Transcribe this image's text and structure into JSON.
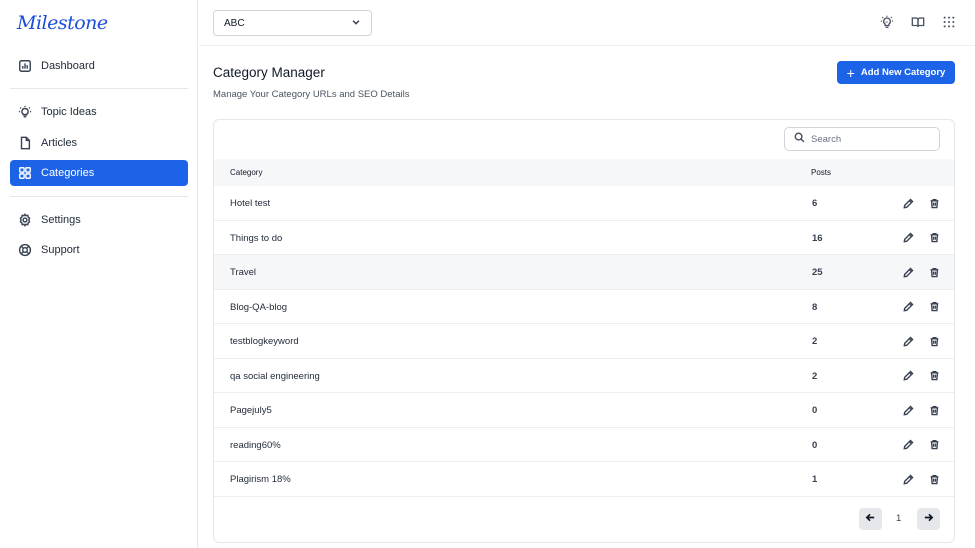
{
  "app": {
    "logo": "Milestone"
  },
  "sidebar": {
    "items": [
      {
        "label": "Dashboard",
        "icon": "chart-bar-icon"
      },
      {
        "label": "Topic Ideas",
        "icon": "lightbulb-icon"
      },
      {
        "label": "Articles",
        "icon": "document-icon"
      },
      {
        "label": "Categories",
        "icon": "grid-icon",
        "active": true
      },
      {
        "label": "Settings",
        "icon": "gear-icon"
      },
      {
        "label": "Support",
        "icon": "lifebuoy-icon"
      }
    ]
  },
  "topbar": {
    "site_selected": "ABC",
    "icons": [
      "ai-bulb-icon",
      "book-icon",
      "apps-grid-icon"
    ]
  },
  "main": {
    "title": "Category Manager",
    "subtitle": "Manage Your Category URLs and SEO Details",
    "add_button_label": "Add New Category",
    "search_placeholder": "Search",
    "table": {
      "headers": {
        "category": "Category",
        "posts": "Posts"
      },
      "rows": [
        {
          "category": "Hotel test",
          "posts": "6"
        },
        {
          "category": "Things to do",
          "posts": "16"
        },
        {
          "category": "Travel",
          "posts": "25"
        },
        {
          "category": "Blog-QA-blog",
          "posts": "8"
        },
        {
          "category": "testblogkeyword",
          "posts": "2"
        },
        {
          "category": "qa social engineering",
          "posts": "2"
        },
        {
          "category": "Pagejuly5",
          "posts": "0"
        },
        {
          "category": "reading60%",
          "posts": "0"
        },
        {
          "category": "Plagirism 18%",
          "posts": "1"
        }
      ]
    },
    "pagination": {
      "current_page": "1"
    }
  },
  "colors": {
    "accent": "#1d63e8",
    "logo": "#1d4ed8",
    "row_highlight": "#f6f7f9"
  }
}
